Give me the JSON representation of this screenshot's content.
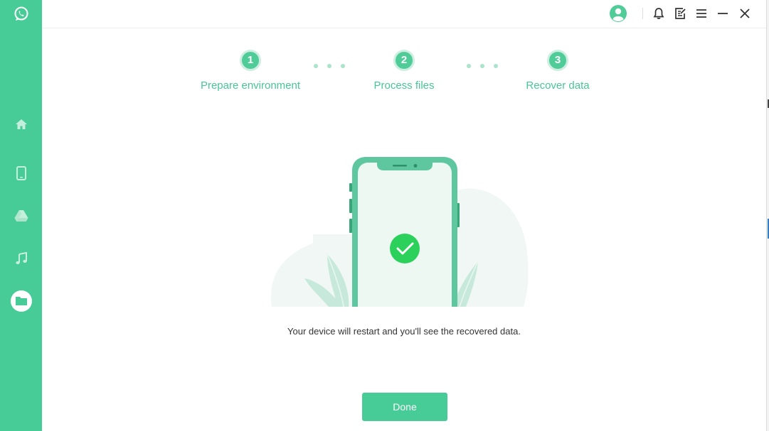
{
  "sidebar": {
    "logo_icon": "whatsapp-logo",
    "items": [
      {
        "icon": "home-icon"
      },
      {
        "icon": "phone-icon"
      },
      {
        "icon": "google-drive-icon"
      },
      {
        "icon": "music-icon"
      },
      {
        "icon": "folder-icon",
        "active": true
      }
    ]
  },
  "topbar": {
    "icons": [
      "user-avatar-icon",
      "bell-icon",
      "edit-icon",
      "menu-icon",
      "minimize-icon",
      "close-icon"
    ]
  },
  "steps": [
    {
      "number": "1",
      "label": "Prepare environment"
    },
    {
      "number": "2",
      "label": "Process files"
    },
    {
      "number": "3",
      "label": "Recover data"
    }
  ],
  "message": "Your device will restart and you'll see the recovered data.",
  "done_button": "Done",
  "colors": {
    "accent": "#47cb97",
    "success": "#2bd15a"
  }
}
